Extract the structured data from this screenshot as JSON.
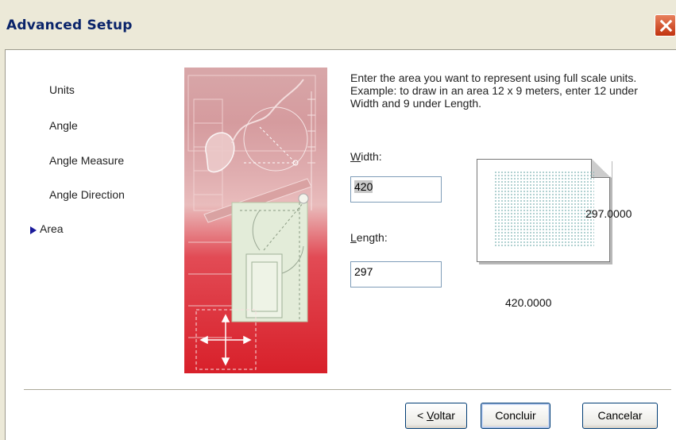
{
  "window": {
    "title": "Advanced Setup",
    "close_icon": "close-icon"
  },
  "steps": [
    {
      "label": "Units",
      "current": false
    },
    {
      "label": "Angle",
      "current": false
    },
    {
      "label": "Angle Measure",
      "current": false
    },
    {
      "label": "Angle Direction",
      "current": false
    },
    {
      "label": "Area",
      "current": true
    }
  ],
  "instruction": "Enter the area you want to represent using full scale units.  Example: to draw in an area 12 x 9 meters, enter 12 under Width and 9 under Length.",
  "width_field": {
    "label_mnemonic": "W",
    "label_rest": "idth:",
    "value": "420"
  },
  "length_field": {
    "label_mnemonic": "L",
    "label_rest": "ength:",
    "value": "297"
  },
  "preview": {
    "height_value": "297.0000",
    "width_value": "420.0000"
  },
  "buttons": {
    "back_prefix": "< ",
    "back_mnemonic": "V",
    "back_rest": "oltar",
    "finish": "Concluir",
    "cancel": "Cancelar"
  },
  "colors": {
    "title_text": "#0A246A",
    "step_arrow": "#1a1a9a",
    "close_button": "#C1330F"
  }
}
